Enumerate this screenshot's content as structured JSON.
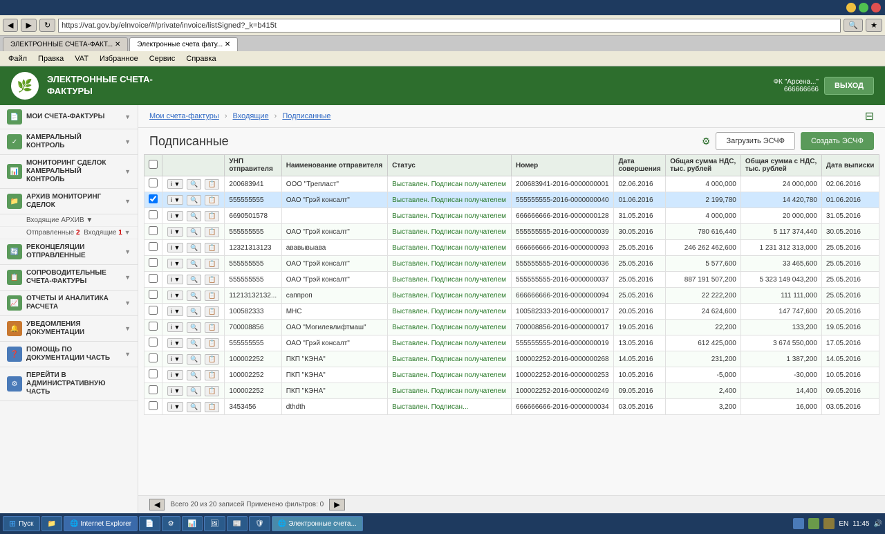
{
  "browser": {
    "address": "https://vat.gov.by/elnvoice/#/private/invoice/listSigned?_k=b415t",
    "tabs": [
      {
        "label": "ЭЛЕКТРОННЫЕ СЧЕТА-ФАКТ...",
        "active": false
      },
      {
        "label": "Электронные счета фату...",
        "active": true
      }
    ],
    "menu": [
      "Файл",
      "Правка",
      "VAT",
      "Избранное",
      "Сервис",
      "Справка"
    ]
  },
  "header": {
    "logo_text": "🌿",
    "app_title_line1": "ЭЛЕКТРОННЫЕ СЧЕТА-",
    "app_title_line2": "ФАКТУРЫ",
    "user_name": "ФК \"Арсена...\"",
    "user_id": "666666666",
    "logout_label": "ВЫХОД"
  },
  "sidebar": {
    "items": [
      {
        "id": "my-invoices",
        "label": "МОИ СЧЕТА-ФАКТУРЫ",
        "icon": "📄",
        "has_arrow": true
      },
      {
        "id": "cam-control",
        "label": "КАМЕРАЛЬНЫЙ КОНТРОЛЬ",
        "icon": "✓",
        "has_arrow": true
      },
      {
        "id": "monitoring",
        "label": "МОНИТОРИНГ СДЕЛОК КАМЕРАЛЬНЫЙ КОНТРОЛЬ",
        "icon": "📊",
        "has_arrow": true
      },
      {
        "id": "archive",
        "label": "АРХИВ МОНИТОРИНГ СДЕЛОК",
        "icon": "📁",
        "has_arrow": true
      },
      {
        "id": "incoming",
        "label": "Входящие АРХИВ",
        "icon": "📥",
        "has_arrow": true,
        "sub": true
      },
      {
        "id": "outgoing",
        "label": "Отправленные Входящие",
        "counter": "2 1",
        "has_arrow": true,
        "sub": true
      },
      {
        "id": "reconciliation",
        "label": "РЕКОНЦИЛЯЦИИ ОТПРАВЛЕННЫЕ",
        "icon": "🔄",
        "has_arrow": true
      },
      {
        "id": "documents",
        "label": "СОПРОВОДИТЕЛЬНЫЕ СЧЕТА-ФАКТУРЫ",
        "icon": "📋",
        "has_arrow": true
      },
      {
        "id": "reports",
        "label": "ОТЧЕТЫ И АНАЛИТИКА РАСЧЕТА",
        "icon": "📈",
        "has_arrow": true
      },
      {
        "id": "notifications",
        "label": "УВЕДОМЛЕНИЯ ДОКУМЕНТАЦИИ",
        "icon": "🔔",
        "has_arrow": true
      },
      {
        "id": "help",
        "label": "ПОМОЩЬ ПО ДОКУМЕНТАЦИИ ЧАСТЬ",
        "icon": "❓",
        "has_arrow": true
      },
      {
        "id": "admin",
        "label": "ПЕРЕЙТИ В АДМИНИСТРАТИВНУЮ ЧАСТЬ",
        "icon": "⚙",
        "has_arrow": false
      }
    ]
  },
  "breadcrumb": {
    "items": [
      "Мои счета-фактуры",
      "Входящие",
      "Подписанные"
    ]
  },
  "page": {
    "title": "Подписанные",
    "load_btn": "Загрузить ЭСЧФ",
    "create_btn": "Создать ЭСЧФ"
  },
  "table": {
    "columns": [
      "",
      "",
      "УНП отправителя",
      "Наименование отправителя",
      "Статус",
      "Номер",
      "Дата совершения",
      "Общая сумма НДС, тыс. рублей",
      "Общая сумма с НДС, тыс. рублей",
      "Дата выписки"
    ],
    "rows": [
      {
        "selected": false,
        "unp": "200683941",
        "name": "ООО \"Трепласт\"",
        "status": "Выставлен. Подписан получателем",
        "number": "200683941-2016-0000000001",
        "date": "02.06.2016",
        "nds": "4 000,000",
        "total": "24 000,000",
        "date_out": "02.06.2016"
      },
      {
        "selected": true,
        "unp": "555555555",
        "name": "ОАО \"Грэй консалт\"",
        "status": "Выставлен. Подписан получателем",
        "number": "555555555-2016-0000000040",
        "date": "01.06.2016",
        "nds": "2 199,780",
        "total": "14 420,780",
        "date_out": "01.06.2016"
      },
      {
        "selected": false,
        "unp": "6690501578",
        "name": "",
        "status": "Выставлен. Подписан получателем",
        "number": "666666666-2016-0000000128",
        "date": "31.05.2016",
        "nds": "4 000,000",
        "total": "20 000,000",
        "date_out": "31.05.2016"
      },
      {
        "selected": false,
        "unp": "555555555",
        "name": "ОАО \"Грэй консалт\"",
        "status": "Выставлен. Подписан получателем",
        "number": "555555555-2016-0000000039",
        "date": "30.05.2016",
        "nds": "780 616,440",
        "total": "5 117 374,440",
        "date_out": "30.05.2016"
      },
      {
        "selected": false,
        "unp": "12321313123",
        "name": "ававывыава",
        "status": "Выставлен. Подписан получателем",
        "number": "666666666-2016-0000000093",
        "date": "25.05.2016",
        "nds": "246 262 462,600",
        "total": "1 231 312 313,000",
        "date_out": "25.05.2016"
      },
      {
        "selected": false,
        "unp": "555555555",
        "name": "ОАО \"Грэй консалт\"",
        "status": "Выставлен. Подписан получателем",
        "number": "555555555-2016-0000000036",
        "date": "25.05.2016",
        "nds": "5 577,600",
        "total": "33 465,600",
        "date_out": "25.05.2016"
      },
      {
        "selected": false,
        "unp": "555555555",
        "name": "ОАО \"Грэй консалт\"",
        "status": "Выставлен. Подписан получателем",
        "number": "555555555-2016-0000000037",
        "date": "25.05.2016",
        "nds": "887 191 507,200",
        "total": "5 323 149 043,200",
        "date_out": "25.05.2016"
      },
      {
        "selected": false,
        "unp": "11213132132...",
        "name": "саппроп",
        "status": "Выставлен. Подписан получателем",
        "number": "666666666-2016-0000000094",
        "date": "25.05.2016",
        "nds": "22 222,200",
        "total": "111 111,000",
        "date_out": "25.05.2016"
      },
      {
        "selected": false,
        "unp": "100582333",
        "name": "МНС",
        "status": "Выставлен. Подписан получателем",
        "number": "100582333-2016-0000000017",
        "date": "20.05.2016",
        "nds": "24 624,600",
        "total": "147 747,600",
        "date_out": "20.05.2016"
      },
      {
        "selected": false,
        "unp": "700008856",
        "name": "ОАО \"Могилевлифтмаш\"",
        "status": "Выставлен. Подписан получателем",
        "number": "700008856-2016-0000000017",
        "date": "19.05.2016",
        "nds": "22,200",
        "total": "133,200",
        "date_out": "19.05.2016"
      },
      {
        "selected": false,
        "unp": "555555555",
        "name": "ОАО \"Грэй консалт\"",
        "status": "Выставлен. Подписан получателем",
        "number": "555555555-2016-0000000019",
        "date": "13.05.2016",
        "nds": "612 425,000",
        "total": "3 674 550,000",
        "date_out": "17.05.2016"
      },
      {
        "selected": false,
        "unp": "100002252",
        "name": "ПКП \"КЭНА\"",
        "status": "Выставлен. Подписан получателем",
        "number": "100002252-2016-0000000268",
        "date": "14.05.2016",
        "nds": "231,200",
        "total": "1 387,200",
        "date_out": "14.05.2016"
      },
      {
        "selected": false,
        "unp": "100002252",
        "name": "ПКП \"КЭНА\"",
        "status": "Выставлен. Подписан получателем",
        "number": "100002252-2016-0000000253",
        "date": "10.05.2016",
        "nds": "-5,000",
        "total": "-30,000",
        "date_out": "10.05.2016"
      },
      {
        "selected": false,
        "unp": "100002252",
        "name": "ПКП \"КЭНА\"",
        "status": "Выставлен. Подписан получателем",
        "number": "100002252-2016-0000000249",
        "date": "09.05.2016",
        "nds": "2,400",
        "total": "14,400",
        "date_out": "09.05.2016"
      },
      {
        "selected": false,
        "unp": "3453456",
        "name": "dthdth",
        "status": "Выставлен. Подписан...",
        "number": "666666666-2016-0000000034",
        "date": "03.05.2016",
        "nds": "3,200",
        "total": "16,000",
        "date_out": "03.05.2016"
      }
    ]
  },
  "footer": {
    "total_text": "Всего 20 из 20 записей Применено фильтров: 0"
  },
  "taskbar": {
    "start_label": "Пуск",
    "time": "11:45",
    "lang": "EN"
  }
}
